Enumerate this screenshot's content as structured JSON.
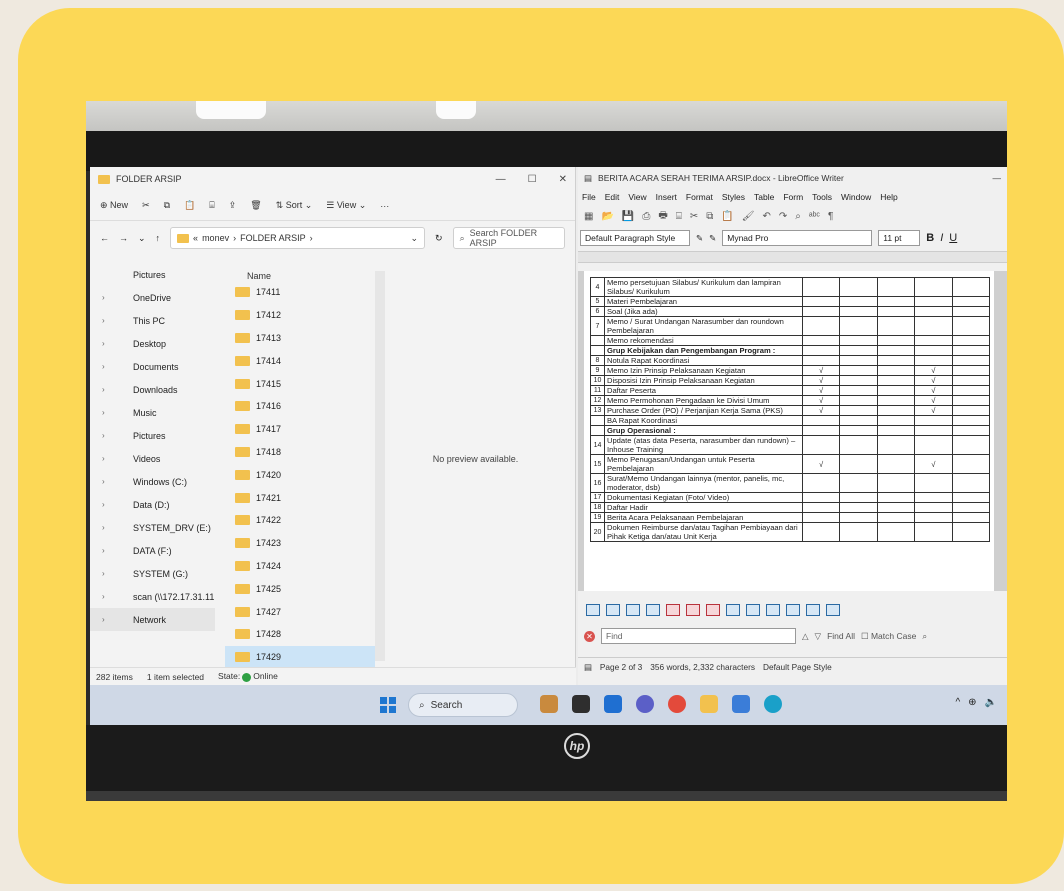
{
  "explorer": {
    "title": "FOLDER ARSIP",
    "toolbar": {
      "new": "New",
      "sort": "Sort",
      "view": "View",
      "more": "···"
    },
    "address": {
      "root": "«",
      "path1": "monev",
      "sep": "›",
      "path2": "FOLDER ARSIP"
    },
    "search_placeholder": "Search FOLDER ARSIP",
    "nav": [
      {
        "label": "Pictures",
        "icon": "pictures-icon",
        "color": "#3b7dd8"
      },
      {
        "label": "OneDrive",
        "icon": "cloud-icon",
        "color": "#1f6fd1"
      },
      {
        "label": "This PC",
        "icon": "computer-icon",
        "color": "#3b7dd8"
      },
      {
        "label": "Desktop",
        "icon": "desktop-icon",
        "color": "#2f88d8"
      },
      {
        "label": "Documents",
        "icon": "documents-icon",
        "color": "#6b7a8c"
      },
      {
        "label": "Downloads",
        "icon": "download-icon",
        "color": "#2d7ad1"
      },
      {
        "label": "Music",
        "icon": "music-icon",
        "color": "#e05a2a"
      },
      {
        "label": "Pictures",
        "icon": "pictures-icon",
        "color": "#3b7dd8"
      },
      {
        "label": "Videos",
        "icon": "videos-icon",
        "color": "#7b3fd0"
      },
      {
        "label": "Windows (C:)",
        "icon": "drive-icon",
        "color": "#6b7a8c"
      },
      {
        "label": "Data (D:)",
        "icon": "drive-icon",
        "color": "#6b7a8c"
      },
      {
        "label": "SYSTEM_DRV (E:)",
        "icon": "drive-icon",
        "color": "#444444"
      },
      {
        "label": "DATA (F:)",
        "icon": "drive-icon",
        "color": "#6b7a8c"
      },
      {
        "label": "SYSTEM (G:)",
        "icon": "drive-icon",
        "color": "#6b7a8c"
      },
      {
        "label": "scan (\\\\172.17.31.11",
        "icon": "network-drive-icon",
        "color": "#2ea043"
      },
      {
        "label": "Network",
        "icon": "network-icon",
        "color": "#3b7dd8"
      }
    ],
    "column_name": "Name",
    "files": [
      "17411",
      "17412",
      "17413",
      "17414",
      "17415",
      "17416",
      "17417",
      "17418",
      "17420",
      "17421",
      "17422",
      "17423",
      "17424",
      "17425",
      "17427",
      "17428",
      "17429"
    ],
    "selected_file": "17429",
    "preview_text": "No preview available.",
    "status": {
      "items": "282 items",
      "selected": "1 item selected",
      "state": "State:",
      "online": "Online"
    }
  },
  "writer": {
    "title": "BERITA ACARA SERAH TERIMA ARSIP.docx - LibreOffice Writer",
    "menu": [
      "File",
      "Edit",
      "View",
      "Insert",
      "Format",
      "Styles",
      "Table",
      "Form",
      "Tools",
      "Window",
      "Help"
    ],
    "paragraph_style": "Default Paragraph Style",
    "font_name": "Mynad Pro",
    "font_size": "11 pt",
    "rows": [
      {
        "no": "4",
        "desc": "Memo persetujuan Silabus/ Kurikulum dan lampiran Silabus/ Kurikulum",
        "bold": false,
        "c1": "",
        "c4": ""
      },
      {
        "no": "5",
        "desc": "Materi Pembelajaran",
        "bold": false,
        "c1": "",
        "c4": ""
      },
      {
        "no": "6",
        "desc": "Soal (Jika ada)",
        "bold": false,
        "c1": "",
        "c4": ""
      },
      {
        "no": "7",
        "desc": "Memo / Surat Undangan Narasumber dan roundown Pembelajaran",
        "bold": false,
        "c1": "",
        "c4": ""
      },
      {
        "no": "",
        "desc": "Memo rekomendasi",
        "bold": false,
        "c1": "",
        "c4": ""
      },
      {
        "no": "",
        "desc": "Grup Kebijakan dan Pengembangan Program :",
        "bold": true,
        "c1": "",
        "c4": ""
      },
      {
        "no": "8",
        "desc": "Notula Rapat Koordinasi",
        "bold": false,
        "c1": "",
        "c4": ""
      },
      {
        "no": "9",
        "desc": "Memo Izin Prinsip Pelaksanaan Kegiatan",
        "bold": false,
        "c1": "√",
        "c4": "√"
      },
      {
        "no": "10",
        "desc": "Disposisi Izin Prinsip Pelaksanaan Kegiatan",
        "bold": false,
        "c1": "√",
        "c4": "√"
      },
      {
        "no": "11",
        "desc": "Daftar Peserta",
        "bold": false,
        "c1": "√",
        "c4": "√"
      },
      {
        "no": "12",
        "desc": "Memo Permohonan Pengadaan ke Divisi Umum",
        "bold": false,
        "c1": "√",
        "c4": "√"
      },
      {
        "no": "13",
        "desc": "Purchase Order (PO) / Perjanjian Kerja Sama (PKS)",
        "bold": false,
        "c1": "√",
        "c4": "√"
      },
      {
        "no": "",
        "desc": "BA Rapat Koordinasi",
        "bold": false,
        "c1": "",
        "c4": ""
      },
      {
        "no": "",
        "desc": "Grup Operasional :",
        "bold": true,
        "c1": "",
        "c4": ""
      },
      {
        "no": "14",
        "desc": "Update (atas data Peserta, narasumber dan rundown) – Inhouse Training",
        "bold": false,
        "c1": "",
        "c4": ""
      },
      {
        "no": "15",
        "desc": "Memo Penugasan/Undangan untuk Peserta Pembelajaran",
        "bold": false,
        "c1": "√",
        "c4": "√"
      },
      {
        "no": "16",
        "desc": "Surat/Memo Undangan lainnya (mentor, panelis, mc, moderator, dsb)",
        "bold": false,
        "c1": "",
        "c4": ""
      },
      {
        "no": "17",
        "desc": "Dokumentasi Kegiatan (Foto/ Video)",
        "bold": false,
        "c1": "",
        "c4": ""
      },
      {
        "no": "18",
        "desc": "Daftar Hadir",
        "bold": false,
        "c1": "",
        "c4": ""
      },
      {
        "no": "19",
        "desc": "Berita Acara Pelaksanaan Pembelajaran",
        "bold": false,
        "c1": "",
        "c4": ""
      },
      {
        "no": "20",
        "desc": "Dokumen Reimburse dan/atau Tagihan Pembiayaan dari Pihak Ketiga dan/atau Unit Kerja",
        "bold": false,
        "c1": "",
        "c4": ""
      }
    ],
    "find_placeholder": "Find",
    "find_all": "Find All",
    "match_case": "Match Case",
    "status": {
      "page": "Page 2 of 3",
      "words": "356 words, 2,332 characters",
      "page_style": "Default Page Style"
    }
  },
  "taskbar": {
    "search_label": "Search",
    "tray": "^"
  },
  "brand": {
    "frame": "#fcd856",
    "accent": "#1f77d0"
  }
}
